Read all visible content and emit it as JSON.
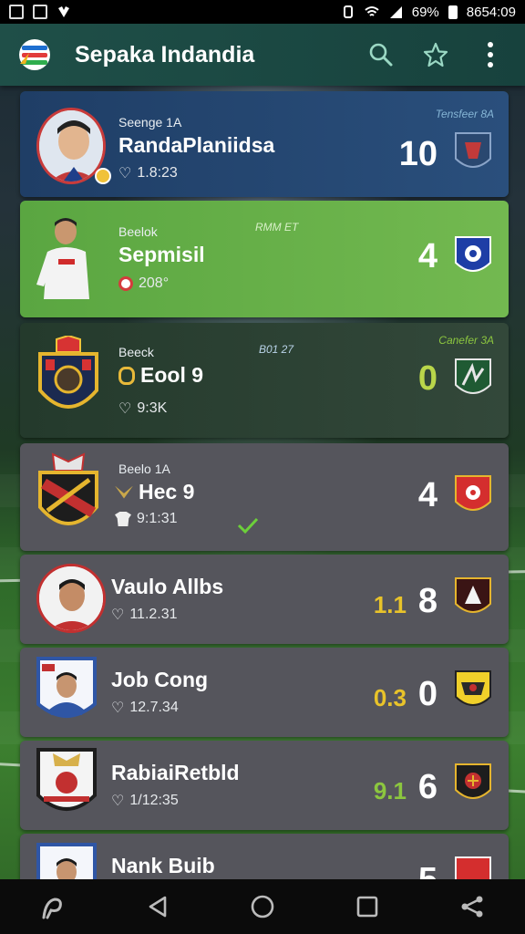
{
  "status_bar": {
    "time": "8654:09",
    "battery": "69%"
  },
  "app_bar": {
    "title": "Sepaka Indandia"
  },
  "cards": [
    {
      "sub": "Seenge 1A",
      "name": "RandaPlaniidsa",
      "stat": "1.8:23",
      "corner": "Tensfeer 8A",
      "mid": "",
      "score": "10",
      "odds": ""
    },
    {
      "sub": "Beelok",
      "name": "Sepmisil",
      "stat": "208°",
      "corner": "",
      "mid": "RMM ET",
      "score": "4",
      "odds": ""
    },
    {
      "sub": "Beeck",
      "name": "Eool 9",
      "stat": "9:3K",
      "corner": "Canefer 3A",
      "mid": "B01 27",
      "score": "0",
      "odds": ""
    },
    {
      "sub": "Beelo 1A",
      "name": "Hec 9",
      "stat": "9:1:31",
      "corner": "",
      "mid": "",
      "score": "4",
      "odds": ""
    },
    {
      "sub": "",
      "name": "Vaulo Allbs",
      "stat": "11.2.31",
      "corner": "",
      "mid": "",
      "score": "8",
      "odds": "1.1"
    },
    {
      "sub": "",
      "name": "Job Cong",
      "stat": "12.7.34",
      "corner": "",
      "mid": "",
      "score": "0",
      "odds": "0.3"
    },
    {
      "sub": "",
      "name": "RabiaiRetbld",
      "stat": "1/12:35",
      "corner": "",
      "mid": "",
      "score": "6",
      "odds": "9.1"
    },
    {
      "sub": "",
      "name": "Nank Buib",
      "stat": "",
      "corner": "",
      "mid": "",
      "score": "5",
      "odds": ""
    }
  ],
  "colors": {
    "app_bar": "#1f4f48",
    "card_blue": "#24466f",
    "card_green": "#6ab04a",
    "card_dark_green": "#2c4034",
    "card_grey": "#55555c",
    "odds_yellow": "#e8c32a",
    "odds_green": "#8cc63f",
    "score_green": "#b9d64a"
  }
}
